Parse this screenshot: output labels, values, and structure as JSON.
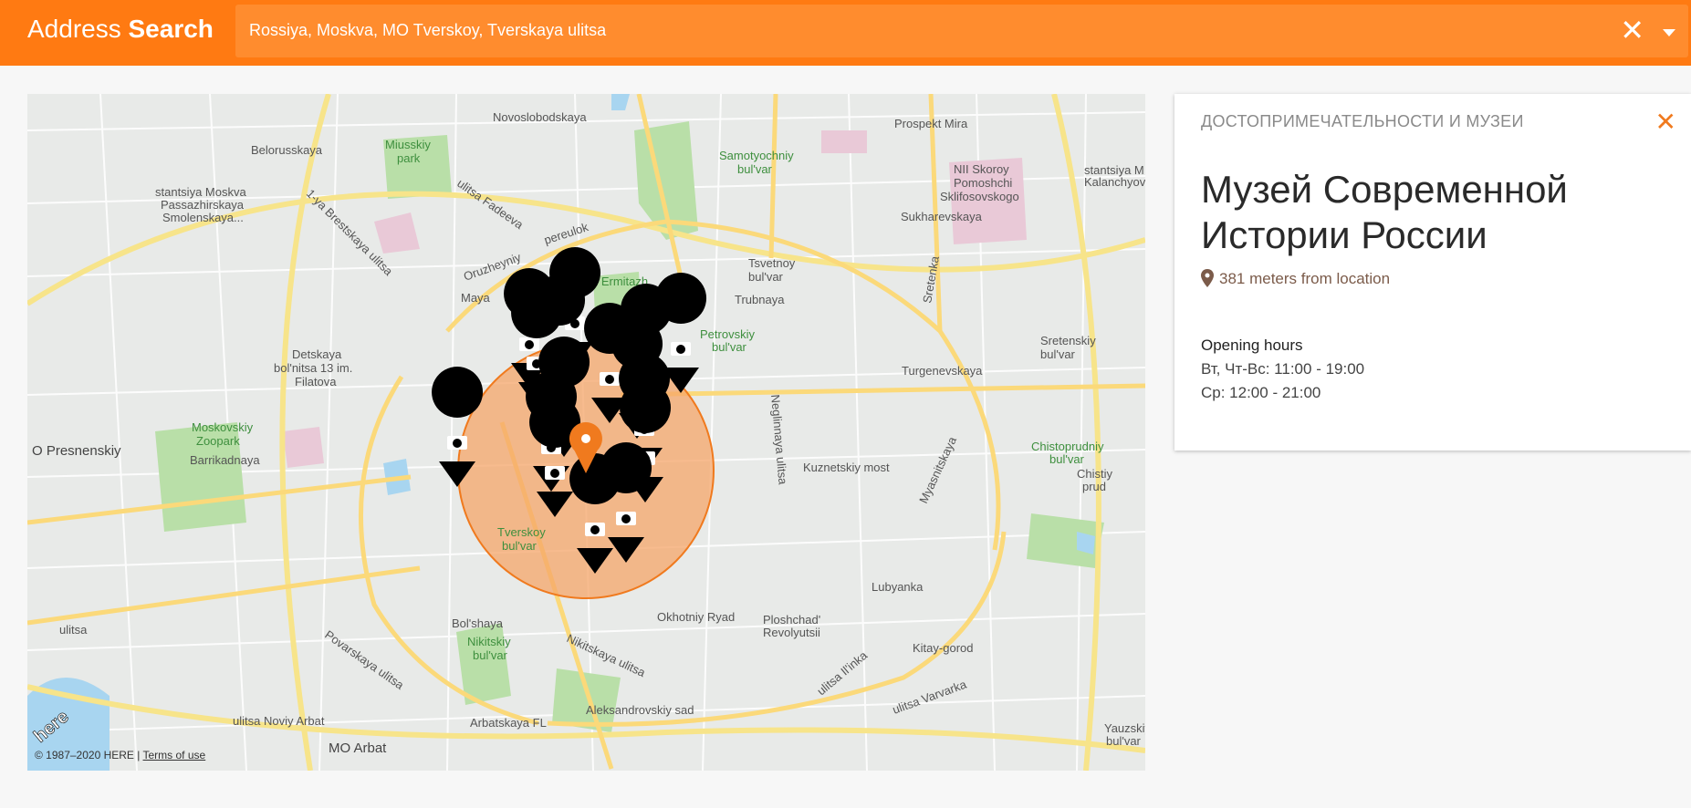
{
  "header": {
    "brand_light": "Address",
    "brand_bold": "Search",
    "search_value": "Rossiya, Moskva, MO Tverskoy, Tverskaya ulitsa",
    "clear_icon": "close-icon",
    "dropdown_icon": "caret-down-icon",
    "accent_color": "#ff7a12"
  },
  "map": {
    "labels": {
      "novoslobodskaya": "Novoslobodskaya",
      "prospekt_mira": "Prospekt Mira",
      "belorusskaya": "Belorusskaya",
      "miusskiy_1": "Miusskiy",
      "miusskiy_2": "park",
      "samotyochniy_1": "Samotyochniy",
      "samotyochniy_2": "bul'var",
      "nii_1": "NII Skoroy",
      "nii_2": "Pomoshchi",
      "nii_3": "Sklifosovskogo",
      "stantsiya_1": "stantsiya Moskva",
      "stantsiya_2": "Passazhirskaya",
      "stantsiya_3": "Smolenskaya...",
      "kalanch_1": "stantsiya M",
      "kalanch_2": "Kalanchyov",
      "fadeeva": "ulitsa Fadeeva",
      "sukharevskaya": "Sukharevskaya",
      "pereulok": "pereulok",
      "oruzheyniy": "Oruzheyniy",
      "brestskaya": "1-ya Brestskaya ulitsa",
      "ermitazh": "d Ermitazh",
      "tsvetnoy_1": "Tsvetnoy",
      "tsvetnoy_2": "bul'var",
      "trubnaya": "Trubnaya",
      "sretenka": "Sretenka",
      "mayak": "Maya",
      "petrovskiy_1": "Petrovskiy",
      "petrovskiy_2": "bul'var",
      "detskaya_1": "Detskaya",
      "detskaya_2": "bol'nitsa 13 im.",
      "detskaya_3": "Filatova",
      "turgenevskaya": "Turgenevskaya",
      "sretenskiy_1": "Sretenskiy",
      "sretenskiy_2": "bul'var",
      "moskovskiy_1": "Moskovskiy",
      "moskovskiy_2": "Zoopark",
      "presnenskiy": "O Presnenskiy",
      "barrikadnaya": "Barrikadnaya",
      "neglinnaya": "Neglinnaya ulitsa",
      "chistoprudniy_1": "Chistoprudniy",
      "chistoprudniy_2": "bul'var",
      "chistiy_1": "Chistiy",
      "chistiy_2": "prud",
      "kuznetskiy": "Kuznetskiy most",
      "myasnitskaya": "Myasnitskaya",
      "lubyanka": "Lubyanka",
      "tverskoy_1": "Tverskoy",
      "tverskoy_2": "bul'var",
      "okhotniy": "Okhotniy Ryad",
      "ploshchad_1": "Ploshchad'",
      "ploshchad_2": "Revolyutsii",
      "bolshaya": "Bol'shaya",
      "nikitskaya": "Nikitskaya ulitsa",
      "nikitskiy_1": "Nikitskiy",
      "nikitskiy_2": "bul'var",
      "povarskaya": "Povarskaya ulitsa",
      "kitay": "Kitay-gorod",
      "ilinka": "ulitsa Il'inka",
      "varvarka": "ulitsa Varvarka",
      "noviy_arbat": "ulitsa Noviy Arbat",
      "arbatskaya": "Arbatskaya FL",
      "aleksandrovskiy": "Aleksandrovskiy sad",
      "mo_arbat": "MO Arbat",
      "yauzskiy_1": "Yauzskiy",
      "yauzskiy_2": "bul'var",
      "ulitsa_left": "ulitsa",
      "here_logo": "here"
    },
    "attribution": "© 1987–2020 HERE |",
    "terms": "Terms of use",
    "radius_color": "#f5a56a",
    "pin_color": "#000000",
    "selected_pin_color": "#f07a1e"
  },
  "panel": {
    "category": "ДОСТОПРИМЕЧАТЕЛЬНОСТИ И МУЗЕИ",
    "title": "Музей Современной Истории России",
    "distance": "381 meters from location",
    "hours_heading": "Opening hours",
    "hours_line1": "Вт, Чт-Вс: 11:00 - 19:00",
    "hours_line2": "Ср: 12:00 - 21:00",
    "close_icon": "close-icon",
    "location_icon": "location-pin-icon"
  }
}
